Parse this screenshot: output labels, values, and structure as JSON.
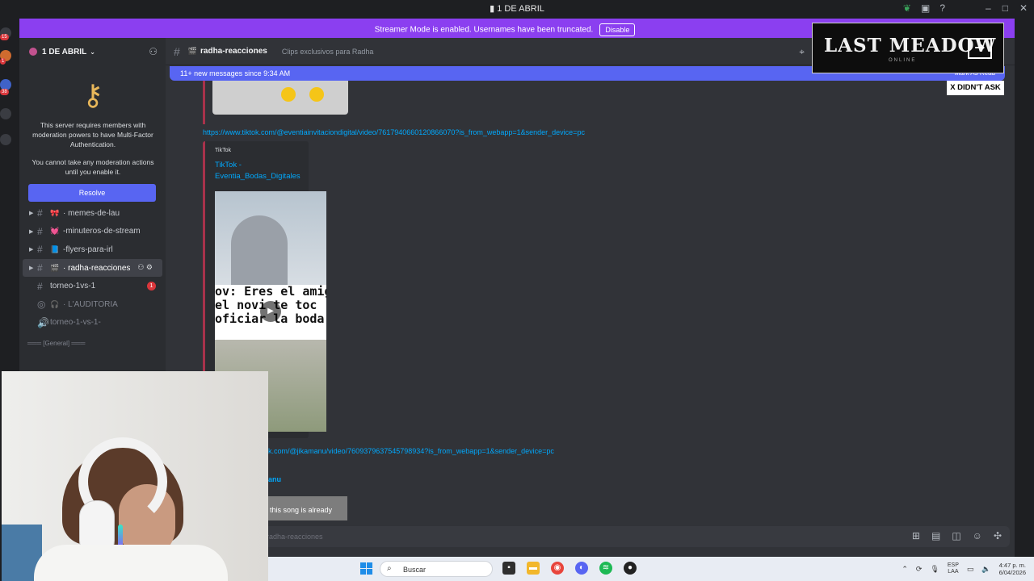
{
  "window": {
    "title": "1 DE ABRIL"
  },
  "streamer_banner": {
    "text": "Streamer Mode is enabled. Usernames have been truncated.",
    "button": "Disable"
  },
  "rail": {
    "badges": [
      "15",
      "1",
      "38"
    ]
  },
  "server": {
    "name": "1 DE ABRIL"
  },
  "mfa": {
    "text1": "This server requires members with moderation powers to have Multi-Factor Authentication.",
    "text2": "You cannot take any moderation actions until you enable it.",
    "button": "Resolve"
  },
  "channels": [
    {
      "label": "· memes-de-lau",
      "emoji": "🎀"
    },
    {
      "label": "-minuteros-de-stream",
      "emoji": "💓"
    },
    {
      "label": "-flyers-para-irl",
      "emoji": "📘"
    },
    {
      "label": "· radha-reacciones",
      "emoji": "🎬",
      "active": true
    },
    {
      "label": "torneo-1vs-1",
      "badge": "1"
    },
    {
      "label": "· L'AUDITORIA",
      "emoji": "🎧",
      "voice": true
    },
    {
      "label": "torneo-1-vs-1-",
      "voice": true
    }
  ],
  "category": "═══ [General] ═══",
  "channel_header": {
    "name": "radha-reacciones",
    "topic": "Clips exclusivos para Radha"
  },
  "new_messages": {
    "text": "11+ new messages since 9:34 AM",
    "mark": "Mark As Read"
  },
  "messages": {
    "link1": "https://www.tiktok.com/@eventiainvitaciondigital/video/7617940660120866070?is_from_webapp=1&sender_device=pc",
    "embed_provider": "TikTok",
    "embed_title": "TikTok - Eventia_Bodas_Digitales",
    "video_caption": [
      "ov: Eres el amig",
      "el novi   te toc",
      "oficiar la boda"
    ],
    "link2": "k.com/@jikamanu/video/7609379637545798934?is_from_webapp=1&sender_device=pc",
    "embed2_title": "anu",
    "thumb2_caption": "this song is already"
  },
  "composer": {
    "placeholder": "radha-reacciones"
  },
  "overlay": {
    "logo": "LAST MEADOW",
    "sub": "ONLINE",
    "tag": "X DIDN'T ASK"
  },
  "taskbar": {
    "search": "Buscar",
    "lang1": "ESP",
    "lang2": "LAA",
    "time": "4:47 p. m.",
    "date": "6/04/2026"
  }
}
